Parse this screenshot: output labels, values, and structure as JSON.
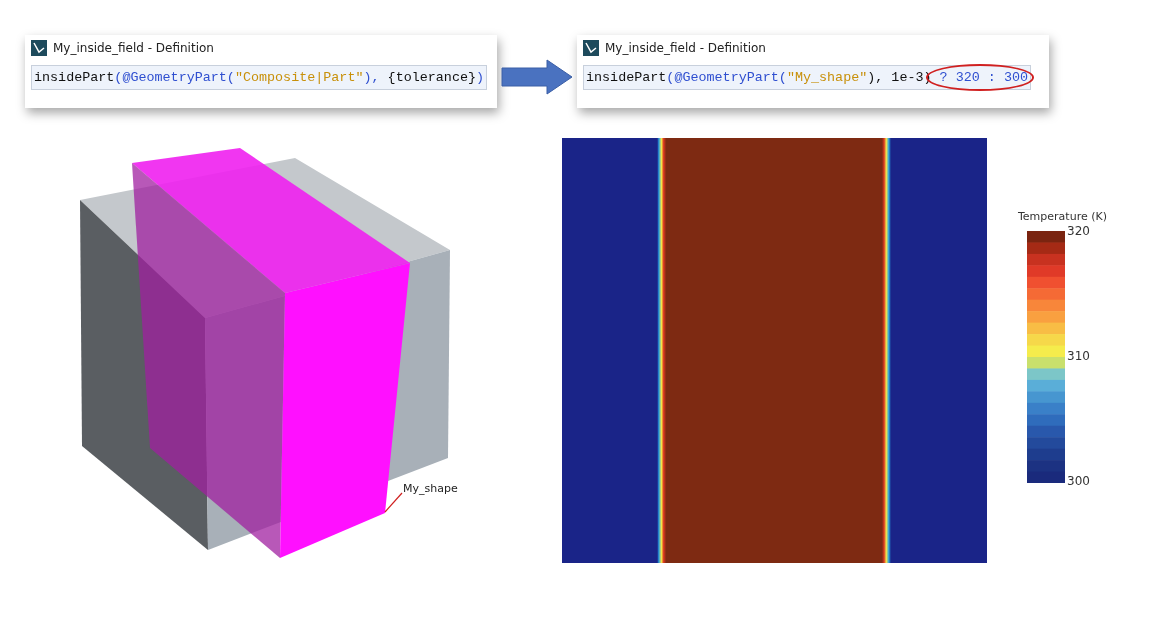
{
  "dialogs": [
    {
      "title": "My_inside_field - Definition",
      "code": [
        {
          "text": "insidePart",
          "kind": "plain",
          "circled": false
        },
        {
          "text": "(@GeometryPart(",
          "kind": "keyword",
          "circled": false
        },
        {
          "text": "\"Composite|Part\"",
          "kind": "string",
          "circled": false
        },
        {
          "text": "), ",
          "kind": "keyword",
          "circled": false
        },
        {
          "text": "{tolerance}",
          "kind": "plain",
          "circled": false
        },
        {
          "text": ")",
          "kind": "keyword",
          "circled": false
        }
      ]
    },
    {
      "title": "My_inside_field - Definition",
      "code": [
        {
          "text": "insidePart",
          "kind": "plain",
          "circled": false
        },
        {
          "text": "(@GeometryPart(",
          "kind": "keyword",
          "circled": false
        },
        {
          "text": "\"My_shape\"",
          "kind": "string",
          "circled": false
        },
        {
          "text": "), 1e-3)",
          "kind": "plain",
          "circled": false
        },
        {
          "text": " ? 320 : 300",
          "kind": "keyword",
          "circled": true
        }
      ]
    }
  ],
  "model_label": "My_shape",
  "legend": {
    "title": "Temperature (K)",
    "ticks": [
      "320",
      "310",
      "300"
    ]
  }
}
